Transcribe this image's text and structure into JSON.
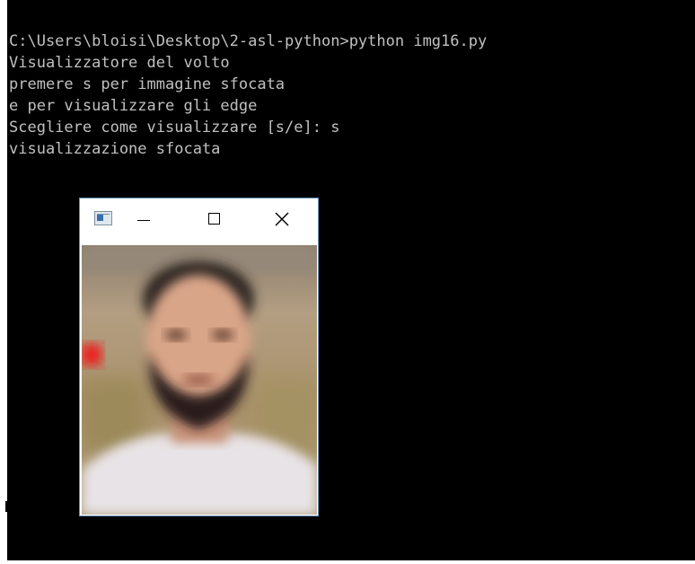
{
  "console": {
    "lines": [
      "C:\\Users\\bloisi\\Desktop\\2-asl-python>python img16.py",
      "Visualizzatore del volto",
      "premere s per immagine sfocata",
      "e per visualizzare gli edge",
      "Scegliere come visualizzare [s/e]: s",
      "visualizzazione sfocata"
    ],
    "background": "#000000",
    "text_color": "#c0c0c0"
  },
  "image_window": {
    "app_icon": "opencv-window-icon",
    "buttons": {
      "minimize": "minimize-icon",
      "maximize": "maximize-icon",
      "close": "close-icon"
    },
    "image": {
      "description_icon": "blurred-face-photo"
    }
  }
}
